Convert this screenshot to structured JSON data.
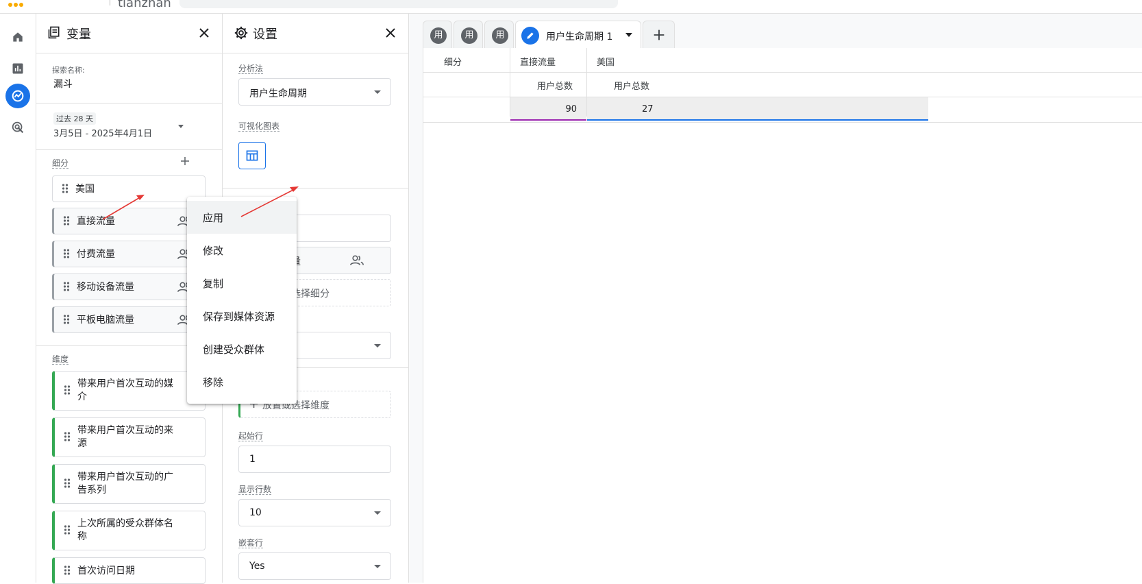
{
  "topbar": {
    "property_name": "tianzhan"
  },
  "rail": {
    "items": [
      "home-icon",
      "reports-icon",
      "explore-icon",
      "advertising-icon"
    ]
  },
  "variables": {
    "title": "变量",
    "explore_name_label": "探索名称:",
    "explore_name": "漏斗",
    "date_badge": "过去 28 天",
    "date_range": "3月5日 - 2025年4月1日",
    "segments_label": "细分",
    "segments": [
      "美国",
      "直接流量",
      "付费流量",
      "移动设备流量",
      "平板电脑流量"
    ],
    "dimensions_label": "维度",
    "dimensions": [
      "带来用户首次互动的媒介",
      "带来用户首次互动的来源",
      "带来用户首次互动的广告系列",
      "上次所属的受众群体名称",
      "首次访问日期"
    ]
  },
  "settings": {
    "title": "设置",
    "technique_label": "分析法",
    "technique_value": "用户生命周期",
    "viz_label": "可视化图表",
    "segment_partial": "量",
    "drop_segment": "选择细分",
    "drop_dimension": "放置或选择维度",
    "start_row_label": "起始行",
    "start_row": "1",
    "show_rows_label": "显示行数",
    "show_rows": "10",
    "nested_rows_label": "嵌套行",
    "nested_rows": "Yes"
  },
  "tabs": {
    "circle_label": "用",
    "active_label": "用户生命周期 1"
  },
  "table": {
    "corner_label": "细分",
    "segment_headers": [
      "直接流量",
      "美国"
    ],
    "metric_headers": [
      "用户总数",
      "用户总数"
    ],
    "values": [
      "90",
      "27"
    ]
  },
  "menu": {
    "items": [
      "应用",
      "修改",
      "复制",
      "保存到媒体资源",
      "创建受众群体",
      "移除"
    ]
  },
  "colors": {
    "accent": "#1a73e8",
    "dimension": "#34a853",
    "arrow": "#e53935",
    "direct_underline": "#9c27b0"
  }
}
